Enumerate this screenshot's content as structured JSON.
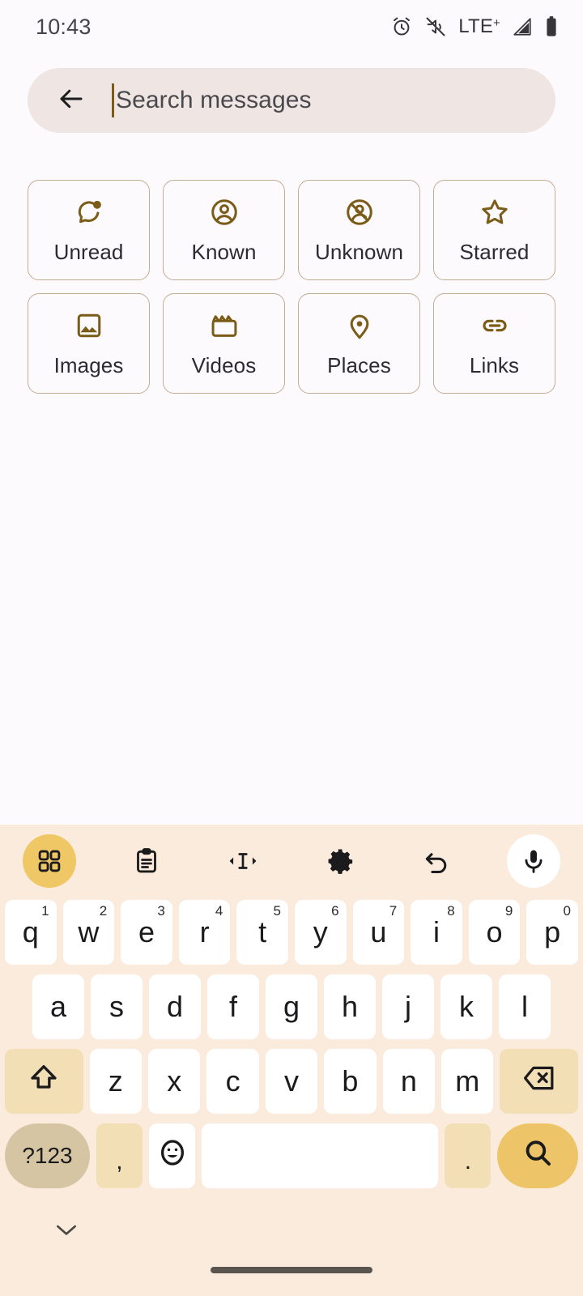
{
  "status_bar": {
    "time": "10:43",
    "network_label": "LTE",
    "network_sup": "+",
    "icons": [
      "alarm-icon",
      "volume-off-icon",
      "signal-icon",
      "battery-icon"
    ]
  },
  "search": {
    "placeholder": "Search messages",
    "value": "",
    "back_label": "Back"
  },
  "filters": [
    {
      "label": "Unread",
      "icon": "unread-chat-icon"
    },
    {
      "label": "Known",
      "icon": "person-circle-icon"
    },
    {
      "label": "Unknown",
      "icon": "person-blocked-icon"
    },
    {
      "label": "Starred",
      "icon": "star-icon"
    },
    {
      "label": "Images",
      "icon": "image-icon"
    },
    {
      "label": "Videos",
      "icon": "video-clapper-icon"
    },
    {
      "label": "Places",
      "icon": "location-pin-icon"
    },
    {
      "label": "Links",
      "icon": "link-icon"
    }
  ],
  "keyboard": {
    "toolbar": [
      {
        "name": "grid-icon",
        "label": "Toolbox"
      },
      {
        "name": "clipboard-icon",
        "label": "Clipboard"
      },
      {
        "name": "text-cursor-icon",
        "label": "Text editing"
      },
      {
        "name": "gear-icon",
        "label": "Settings"
      },
      {
        "name": "undo-icon",
        "label": "Undo"
      },
      {
        "name": "microphone-icon",
        "label": "Voice input"
      }
    ],
    "row1": [
      {
        "key": "q",
        "num": "1"
      },
      {
        "key": "w",
        "num": "2"
      },
      {
        "key": "e",
        "num": "3"
      },
      {
        "key": "r",
        "num": "4"
      },
      {
        "key": "t",
        "num": "5"
      },
      {
        "key": "y",
        "num": "6"
      },
      {
        "key": "u",
        "num": "7"
      },
      {
        "key": "i",
        "num": "8"
      },
      {
        "key": "o",
        "num": "9"
      },
      {
        "key": "p",
        "num": "0"
      }
    ],
    "row2": [
      "a",
      "s",
      "d",
      "f",
      "g",
      "h",
      "j",
      "k",
      "l"
    ],
    "row3": {
      "shift_label": "shift-icon",
      "keys": [
        "z",
        "x",
        "c",
        "v",
        "b",
        "n",
        "m"
      ],
      "backspace_label": "backspace-icon"
    },
    "row4": {
      "symbols_label": "?123",
      "comma_label": ",",
      "emoji_label": "emoji-icon",
      "space_label": "",
      "period_label": ".",
      "search_label": "search-icon"
    },
    "hide_label": "hide-keyboard-icon"
  },
  "colors": {
    "page_bg": "#FDFAFD",
    "search_bg": "#EFE5E2",
    "accent": "#7A5C18",
    "chip_border": "#C2AD92",
    "keyboard_bg": "#FAEBDC",
    "key_bg": "#FFFFFF",
    "fn_key_bg": "#F3DFB5",
    "symbols_key_bg": "#D6C5A3",
    "action_key_bg": "#EDC467"
  }
}
